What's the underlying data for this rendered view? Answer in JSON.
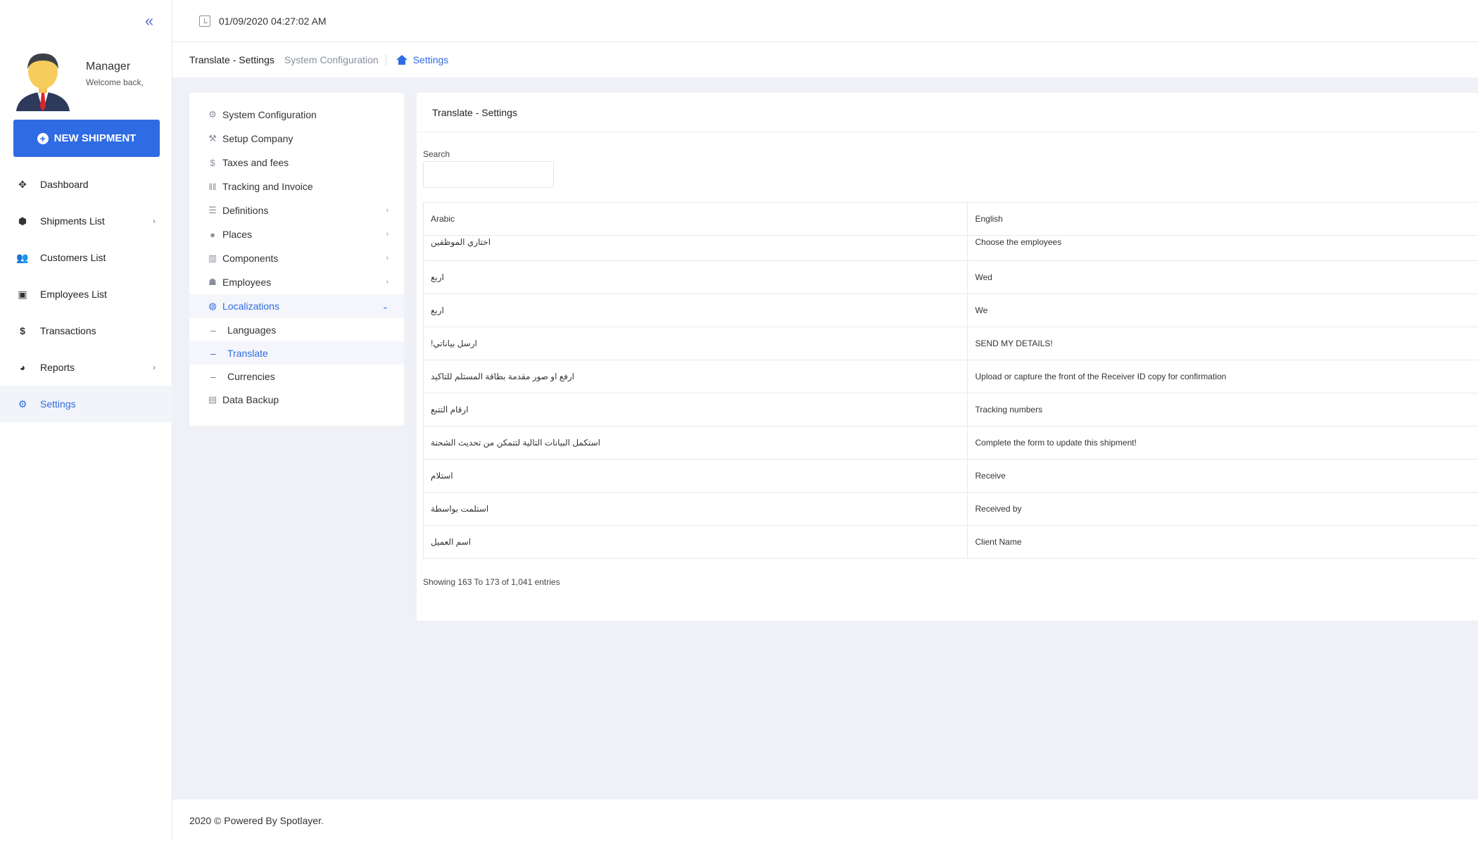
{
  "topbar": {
    "datetime": "01/09/2020 04:27:02 AM"
  },
  "breadcrumb": {
    "title": "Translate - Settings",
    "parent": "System Configuration",
    "current": "Settings"
  },
  "user": {
    "name": "Manager",
    "greeting": "Welcome back,"
  },
  "new_shipment_label": "NEW SHIPMENT",
  "sidebar": {
    "items": [
      {
        "label": "Dashboard",
        "icon": "dashboard-icon"
      },
      {
        "label": "Shipments List",
        "icon": "box-icon"
      },
      {
        "label": "Customers List",
        "icon": "users-icon"
      },
      {
        "label": "Employees List",
        "icon": "id-card-icon"
      },
      {
        "label": "Transactions",
        "icon": "dollar-icon"
      },
      {
        "label": "Reports",
        "icon": "pie-chart-icon"
      },
      {
        "label": "Settings",
        "icon": "settings-icon"
      }
    ]
  },
  "settings_menu": {
    "items": [
      {
        "label": "System Configuration",
        "icon": "gear-icon"
      },
      {
        "label": "Setup Company",
        "icon": "wrench-icon"
      },
      {
        "label": "Taxes and fees",
        "icon": "dollar-icon"
      },
      {
        "label": "Tracking and Invoice",
        "icon": "barcode-icon"
      },
      {
        "label": "Definitions",
        "icon": "list-icon"
      },
      {
        "label": "Places",
        "icon": "globe-icon"
      },
      {
        "label": "Components",
        "icon": "building-icon"
      },
      {
        "label": "Employees",
        "icon": "users-icon"
      },
      {
        "label": "Localizations",
        "icon": "world-icon"
      }
    ],
    "sub_items": [
      {
        "label": "Languages"
      },
      {
        "label": "Translate"
      },
      {
        "label": "Currencies"
      }
    ],
    "backup": {
      "label": "Data Backup",
      "icon": "floppy-icon"
    }
  },
  "card": {
    "title": "Translate - Settings",
    "search_label": "Search"
  },
  "table": {
    "columns": [
      "Arabic",
      "English"
    ],
    "rows": [
      {
        "ar": "اختاري الموظفين",
        "en": "Choose the employees"
      },
      {
        "ar": "اربع",
        "en": "Wed"
      },
      {
        "ar": "اربع",
        "en": "We"
      },
      {
        "ar": "ارسل بياناتي!",
        "en": "SEND MY DETAILS!"
      },
      {
        "ar": "ارفع او صور مقدمة بطاقة المستلم للتاكيد",
        "en": "Upload or capture the front of the Receiver ID copy for confirmation"
      },
      {
        "ar": "ارقام التتبع",
        "en": "Tracking numbers"
      },
      {
        "ar": "استكمل البيانات التالية لتتمكن من تحديث الشحنة",
        "en": "Complete the form to update this shipment!"
      },
      {
        "ar": "استلام",
        "en": "Receive"
      },
      {
        "ar": "استلمت بواسطة",
        "en": "Received by"
      },
      {
        "ar": "اسم العميل",
        "en": "Client Name"
      }
    ],
    "summary": "Showing 163 To 173 of 1,041 entries"
  },
  "footer": {
    "text": "2020 © Powered By Spotlayer."
  },
  "colors": {
    "accent": "#2f6be3",
    "background": "#eff1f6"
  }
}
